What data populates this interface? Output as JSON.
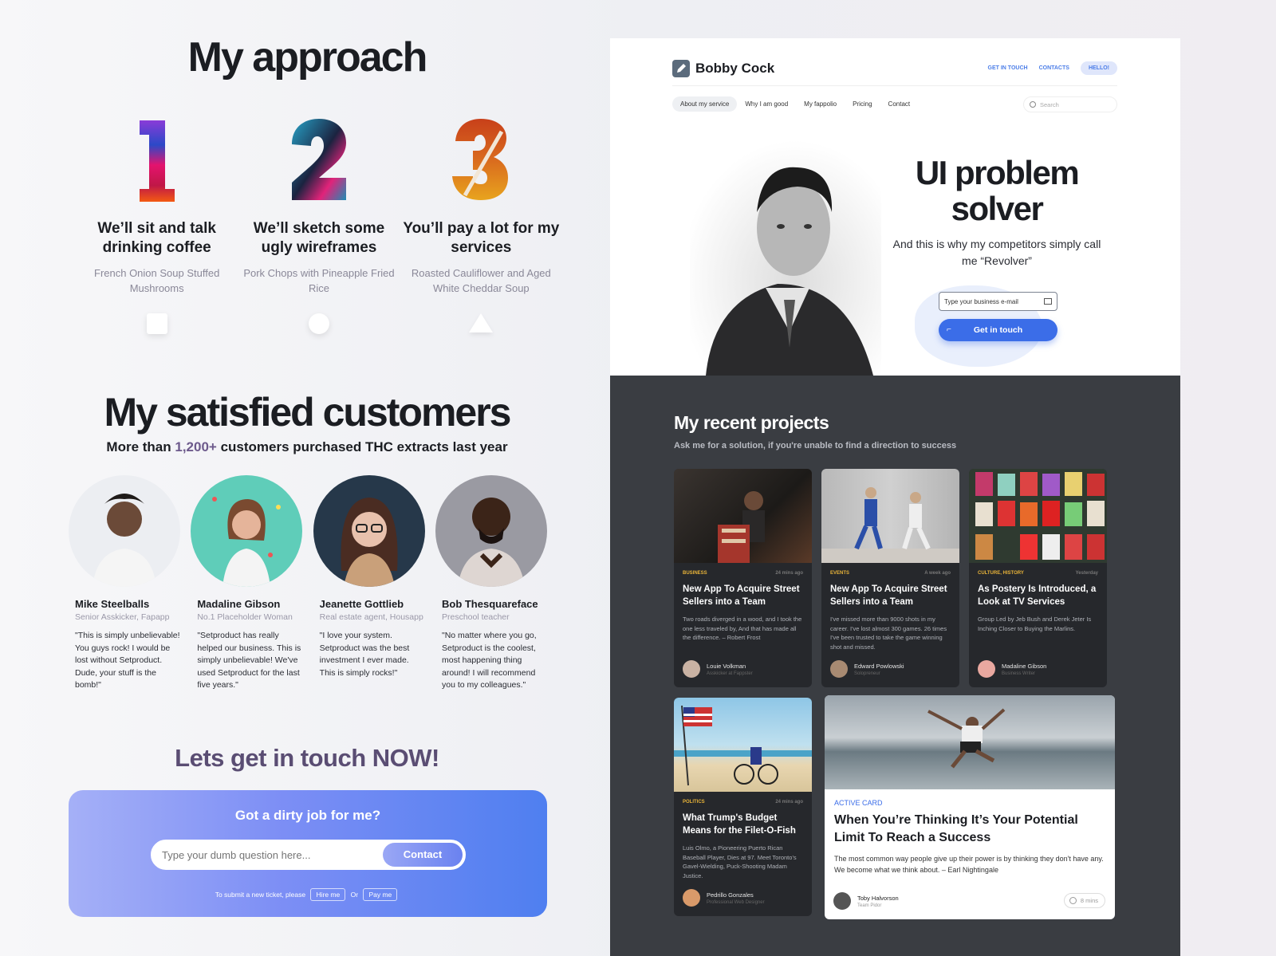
{
  "approach": {
    "title": "My approach",
    "steps": [
      {
        "digit": "1",
        "title": "We’ll sit and talk drinking coffee",
        "text": "French Onion Soup Stuffed Mushrooms",
        "shape": "square"
      },
      {
        "digit": "2",
        "title": "We’ll sketch some ugly wireframes",
        "text": "Pork Chops with Pineapple Fried Rice",
        "shape": "circle"
      },
      {
        "digit": "3",
        "title": "You’ll pay a lot for my services",
        "text": "Roasted Cauliflower and Aged White Cheddar Soup",
        "shape": "triangle"
      }
    ]
  },
  "customers": {
    "title": "My satisfied customers",
    "sub_before": "More than",
    "sub_number": "1,200+",
    "sub_after": "customers purchased THC extracts last year",
    "list": [
      {
        "name": "Mike Steelballs",
        "role": "Senior Asskicker, Fapapp",
        "quote": "\"This is simply unbelievable! You guys rock! I would be lost without Setproduct. Dude, your stuff is the bomb!\""
      },
      {
        "name": "Madaline Gibson",
        "role": "No.1 Placeholder Woman",
        "quote": "\"Setproduct has really helped our business. This is simply unbelievable! We've used Setproduct for the last five years.\""
      },
      {
        "name": "Jeanette Gottlieb",
        "role": "Real estate agent, Housapp",
        "quote": "\"I love your system. Setproduct was the best investment I ever made. This is simply rocks!\""
      },
      {
        "name": "Bob Thesquareface",
        "role": "Preschool teacher",
        "quote": "\"No matter where you go, Setproduct is the coolest, most happening thing around! I will recommend you to my colleagues.\""
      }
    ]
  },
  "touch": {
    "title": "Lets get in touch NOW!",
    "question": "Got a dirty job for me?",
    "placeholder": "Type your dumb question here...",
    "button": "Contact",
    "note_before": "To submit a new ticket, please",
    "hire": "Hire me",
    "or": "Or",
    "pay": "Pay me"
  },
  "site": {
    "brand": "Bobby Cock",
    "header_links": [
      "GET IN TOUCH",
      "CONTACTS",
      "HELLO!"
    ],
    "nav": [
      "About my service",
      "Why I am good",
      "My fappolio",
      "Pricing",
      "Contact"
    ],
    "search_placeholder": "Search",
    "hero_title": "UI problem solver",
    "hero_sub": "And this is why my competitors simply call me “Revolver”",
    "email_placeholder": "Type your business e-mail",
    "cta": "Get in touch"
  },
  "projects": {
    "title": "My recent projects",
    "subtitle": "Ask me for a solution, if you're unable to find a direction to success",
    "cards": [
      {
        "category": "BUSINESS",
        "time": "24 mins ago",
        "title": "New App To Acquire Street Sellers into a Team",
        "excerpt": "Two roads diverged in a wood, and I took the one less traveled by, And that has made all the difference. – Robert Frost",
        "author": "Louie Volkman",
        "author_role": "Asskicker at Fappster"
      },
      {
        "category": "EVENTS",
        "time": "A week ago",
        "title": "New App To Acquire Street Sellers into a Team",
        "excerpt": "I've missed more than 9000 shots in my career. I've lost almost 300 games. 26 times I've been trusted to take the game winning shot and missed.",
        "author": "Edward Powlowski",
        "author_role": "Solopreneur"
      },
      {
        "category": "CULTURE, HISTORY",
        "time": "Yesterday",
        "title": "As Postery Is Introduced, a Look at TV Services",
        "excerpt": "Group Led by Jeb Bush and Derek Jeter Is Inching Closer to Buying the Marlins.",
        "author": "Madaline Gibson",
        "author_role": "Business Writer"
      },
      {
        "category": "POLITICS",
        "time": "24 mins ago",
        "title": "What Trump's Budget Means for the Filet-O-Fish",
        "excerpt": "Luis Olmo, a Pioneering Puerto Rican Baseball Player, Dies at 97. Meet Toronto's Gavel-Wielding, Puck-Shooting Madam Justice.",
        "author": "Pedrillo Gonzales",
        "author_role": "Professional Web Designer"
      }
    ],
    "active_card": {
      "label": "ACTIVE CARD",
      "title": "When You’re Thinking It’s Your Potential Limit To Reach a Success",
      "excerpt": "The most common way people give up their power is by thinking they don't have any. We become what we think about. – Earl Nightingale",
      "author": "Toby Halvorson",
      "author_role": "Team Pidor",
      "time": "8 mins"
    }
  }
}
